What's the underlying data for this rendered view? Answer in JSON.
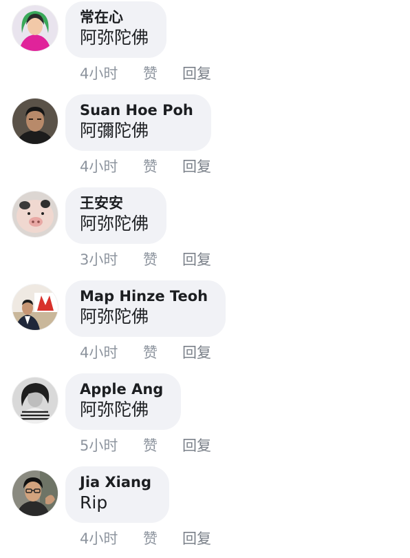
{
  "comments": [
    {
      "author": "常在心",
      "text": "阿弥陀佛",
      "time": "4小时",
      "like_label": "赞",
      "reply_label": "回复",
      "avatar": "avatar-woman-green-hair"
    },
    {
      "author": "Suan Hoe Poh",
      "text": "阿彌陀佛",
      "time": "4小时",
      "like_label": "赞",
      "reply_label": "回复",
      "avatar": "avatar-man"
    },
    {
      "author": "王安安",
      "text": "阿弥陀佛",
      "time": "3小时",
      "like_label": "赞",
      "reply_label": "回复",
      "avatar": "avatar-piglet"
    },
    {
      "author": "Map Hinze Teoh",
      "text": "阿弥陀佛",
      "time": "4小时",
      "like_label": "赞",
      "reply_label": "回复",
      "avatar": "avatar-man-with-logo"
    },
    {
      "author": "Apple Ang",
      "text": "阿弥陀佛",
      "time": "5小时",
      "like_label": "赞",
      "reply_label": "回复",
      "avatar": "avatar-woman-bw"
    },
    {
      "author": "Jia Xiang",
      "text": "Rip",
      "time": "4小时",
      "like_label": "赞",
      "reply_label": "回复",
      "avatar": "avatar-man-glasses"
    }
  ],
  "colors": {
    "bubble": "#f1f2f6",
    "text": "#1c1e21",
    "meta": "#8d949e"
  }
}
